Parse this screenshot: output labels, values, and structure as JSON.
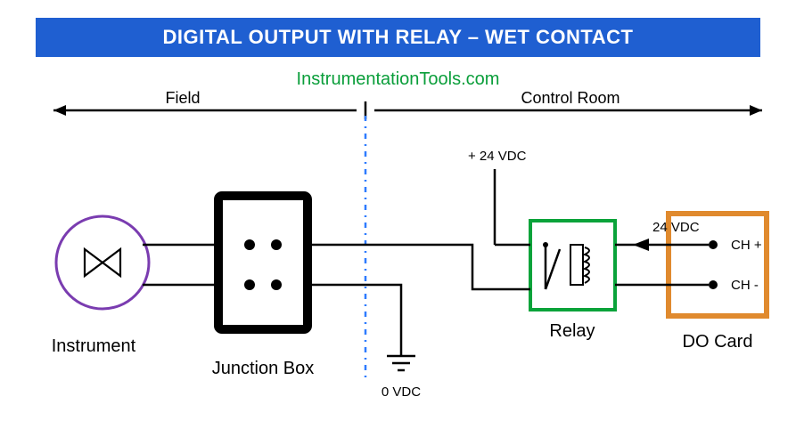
{
  "title": "DIGITAL OUTPUT WITH RELAY – WET CONTACT",
  "site": "InstrumentationTools.com",
  "zones": {
    "field": "Field",
    "control_room": "Control Room"
  },
  "labels": {
    "instrument": "Instrument",
    "junction_box": "Junction Box",
    "relay": "Relay",
    "do_card": "DO Card",
    "plus24": "+ 24 VDC",
    "arrow24": "24 VDC",
    "ch_plus": "CH +",
    "ch_minus": "CH -",
    "zero_vdc": "0 VDC"
  },
  "colors": {
    "title_bg": "#1f5fd1",
    "site": "#0a9e3a",
    "instrument_ring": "#7a3cb0",
    "junction_box": "#000000",
    "divider": "#2e7bff",
    "relay": "#0aa33a",
    "do_card": "#e08a2e"
  }
}
